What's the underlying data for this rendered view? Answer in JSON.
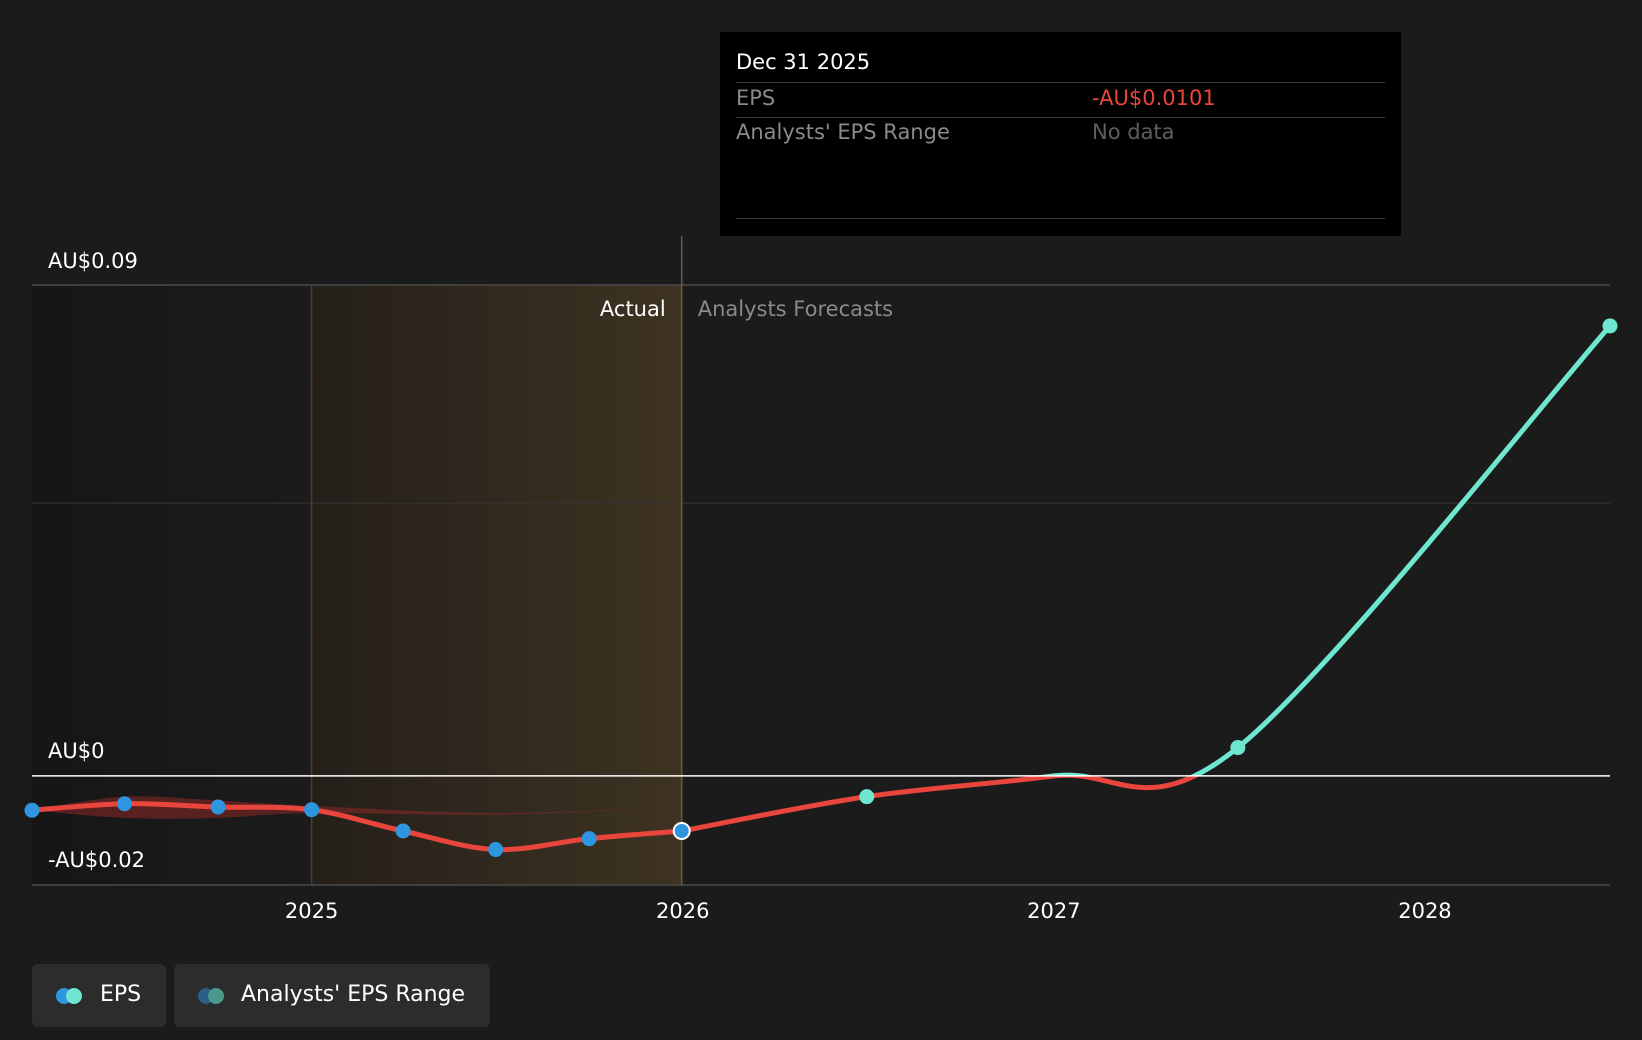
{
  "chart_data": {
    "type": "line",
    "y_axis_labels": {
      "top": "AU$0.09",
      "zero": "AU$0",
      "bottom": "-AU$0.02"
    },
    "ylim": [
      -0.02,
      0.09
    ],
    "xlim": [
      "2024-04-01",
      "2028-07-01"
    ],
    "x_ticks": [
      {
        "label": "2025",
        "date": "2025-01-01"
      },
      {
        "label": "2026",
        "date": "2026-01-01"
      },
      {
        "label": "2027",
        "date": "2027-01-01"
      },
      {
        "label": "2028",
        "date": "2028-01-01"
      }
    ],
    "section_labels": {
      "actual": "Actual",
      "forecast": "Analysts Forecasts"
    },
    "actual_end_date": "2025-12-31",
    "highlight_start_date": "2025-01-01",
    "series": [
      {
        "name": "EPS",
        "kind": "actual",
        "color": "#e8453c",
        "marker_color": "#2e96e0",
        "points": [
          {
            "x": "2024-04-01",
            "y": -0.0063
          },
          {
            "x": "2024-07-01",
            "y": -0.0051
          },
          {
            "x": "2024-10-01",
            "y": -0.0057
          },
          {
            "x": "2025-01-01",
            "y": -0.0062
          },
          {
            "x": "2025-04-01",
            "y": -0.0101
          },
          {
            "x": "2025-07-01",
            "y": -0.0135
          },
          {
            "x": "2025-10-01",
            "y": -0.0115
          },
          {
            "x": "2025-12-31",
            "y": -0.0101
          }
        ]
      },
      {
        "name": "EPS",
        "kind": "forecast",
        "color_negative": "#e8453c",
        "color_positive": "#6ee6d0",
        "points": [
          {
            "x": "2025-12-31",
            "y": -0.0101
          },
          {
            "x": "2026-07-01",
            "y": -0.0038
          },
          {
            "x": "2027-01-01",
            "y": 0.0
          },
          {
            "x": "2027-07-01",
            "y": 0.0052
          },
          {
            "x": "2028-07-01",
            "y": 0.0825
          }
        ],
        "markers": [
          {
            "x": "2026-07-01",
            "y": -0.0038
          },
          {
            "x": "2027-07-01",
            "y": 0.0052
          },
          {
            "x": "2028-07-01",
            "y": 0.0825
          }
        ]
      }
    ],
    "eps_range_band": {
      "color": "#8c2a28",
      "upper": [
        {
          "x": "2024-04-01",
          "y": -0.0063
        },
        {
          "x": "2024-07-01",
          "y": -0.0038
        },
        {
          "x": "2024-10-01",
          "y": -0.0045
        },
        {
          "x": "2025-01-01",
          "y": -0.0055
        },
        {
          "x": "2025-07-01",
          "y": -0.0068
        },
        {
          "x": "2025-12-31",
          "y": -0.0057
        }
      ],
      "lower": [
        {
          "x": "2025-12-31",
          "y": -0.0057
        },
        {
          "x": "2025-07-01",
          "y": -0.0071
        },
        {
          "x": "2025-01-01",
          "y": -0.0068
        },
        {
          "x": "2024-10-01",
          "y": -0.0077
        },
        {
          "x": "2024-07-01",
          "y": -0.0077
        },
        {
          "x": "2024-04-01",
          "y": -0.0063
        }
      ]
    }
  },
  "tooltip": {
    "date": "Dec 31 2025",
    "eps_label": "EPS",
    "eps_value": "-AU$0.0101",
    "range_label": "Analysts' EPS Range",
    "range_value": "No data",
    "eps_value_color": "#e8453c"
  },
  "legend": {
    "eps_label": "EPS",
    "range_label": "Analysts' EPS Range"
  }
}
